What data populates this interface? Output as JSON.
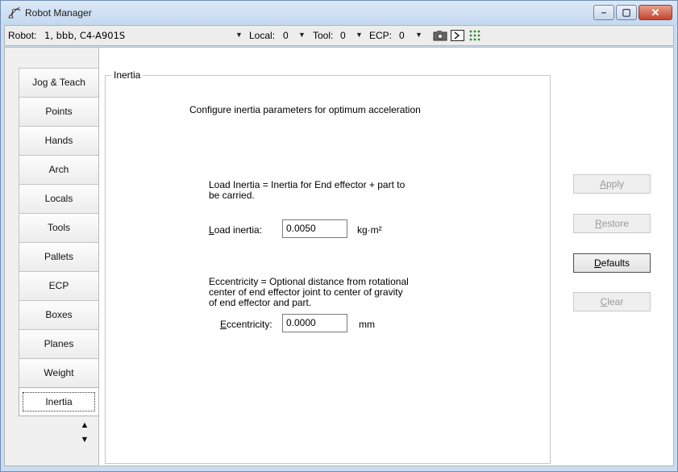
{
  "window": {
    "title": "Robot Manager",
    "caption": {
      "minimize": "–",
      "maximize": "▢",
      "close": "✕"
    }
  },
  "toolbar": {
    "robot_label": "Robot:",
    "robot_value": "1, bbb, C4-A901S",
    "local_label": "Local:",
    "local_value": "0",
    "tool_label": "Tool:",
    "tool_value": "0",
    "ecp_label": "ECP:",
    "ecp_value": "0",
    "icons": [
      "camera-icon",
      "terminal-icon",
      "dot-grid-icon"
    ]
  },
  "tabs": [
    {
      "label": "Jog & Teach"
    },
    {
      "label": "Points"
    },
    {
      "label": "Hands"
    },
    {
      "label": "Arch"
    },
    {
      "label": "Locals"
    },
    {
      "label": "Tools"
    },
    {
      "label": "Pallets"
    },
    {
      "label": "ECP"
    },
    {
      "label": "Boxes"
    },
    {
      "label": "Planes"
    },
    {
      "label": "Weight"
    },
    {
      "label": "Inertia"
    }
  ],
  "active_tab": "Inertia",
  "panel": {
    "group_title": "Inertia",
    "description": "Configure inertia parameters for optimum acceleration",
    "load_help_line1": "Load Inertia = Inertia for End effector + part to",
    "load_help_line2": "be carried.",
    "load_label_accel": "L",
    "load_label_rest": "oad inertia:",
    "load_value": "0.0050",
    "load_unit": "kg·m²",
    "ecc_help_line1": "Eccentricity = Optional distance from rotational",
    "ecc_help_line2": "center of end effector joint to center of gravity",
    "ecc_help_line3": "of end effector and part.",
    "ecc_label_accel": "E",
    "ecc_label_rest": "ccentricity:",
    "ecc_value": "0.0000",
    "ecc_unit": "mm"
  },
  "buttons": {
    "apply_accel": "A",
    "apply_rest": "pply",
    "restore_accel": "R",
    "restore_rest": "estore",
    "defaults_accel": "D",
    "defaults_rest": "efaults",
    "clear_accel": "C",
    "clear_rest": "lear"
  }
}
